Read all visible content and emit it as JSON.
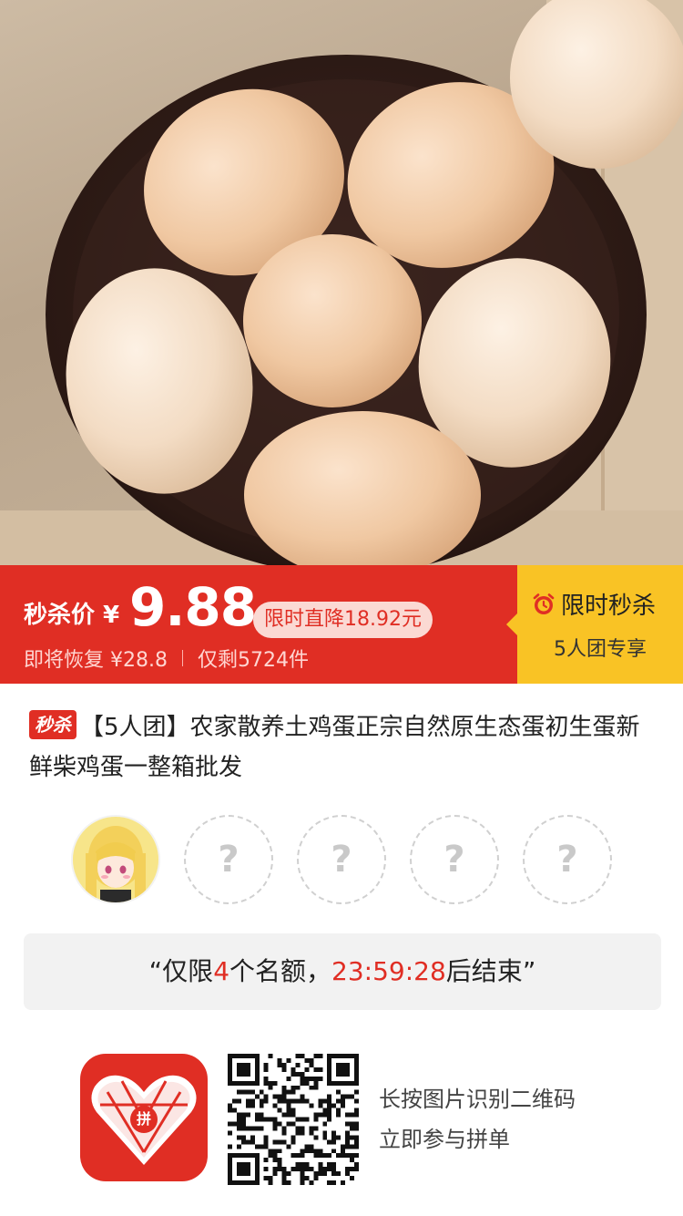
{
  "hero": {
    "image_desc_icon": "eggs-in-bowl-image"
  },
  "price_bar": {
    "seckill_label": "秒杀价 ¥",
    "price": "9.88",
    "drop_badge": "限时直降18.92元",
    "restore_text": "即将恢复 ¥28.8",
    "stock_text": "仅剩5724件",
    "flash_title": "限时秒杀",
    "team_only": "5人团专享"
  },
  "product": {
    "tag": "秒杀",
    "title": "【5人团】农家散养土鸡蛋正宗自然原生态蛋初生蛋新鲜柴鸡蛋一整箱批发"
  },
  "group": {
    "empty_slot_mark": "?",
    "slots": 5
  },
  "quota": {
    "open_quote": "“",
    "prefix": "仅限",
    "count": "4",
    "middle": "个名额，",
    "countdown": "23:59:28",
    "suffix": "后结束",
    "close_quote": "”"
  },
  "footer": {
    "logo_text": "拼",
    "hint_line1": "长按图片识别二维码",
    "hint_line2": "立即参与拼单"
  },
  "colors": {
    "accent_red": "#e02e24",
    "accent_yellow": "#f9c325"
  }
}
